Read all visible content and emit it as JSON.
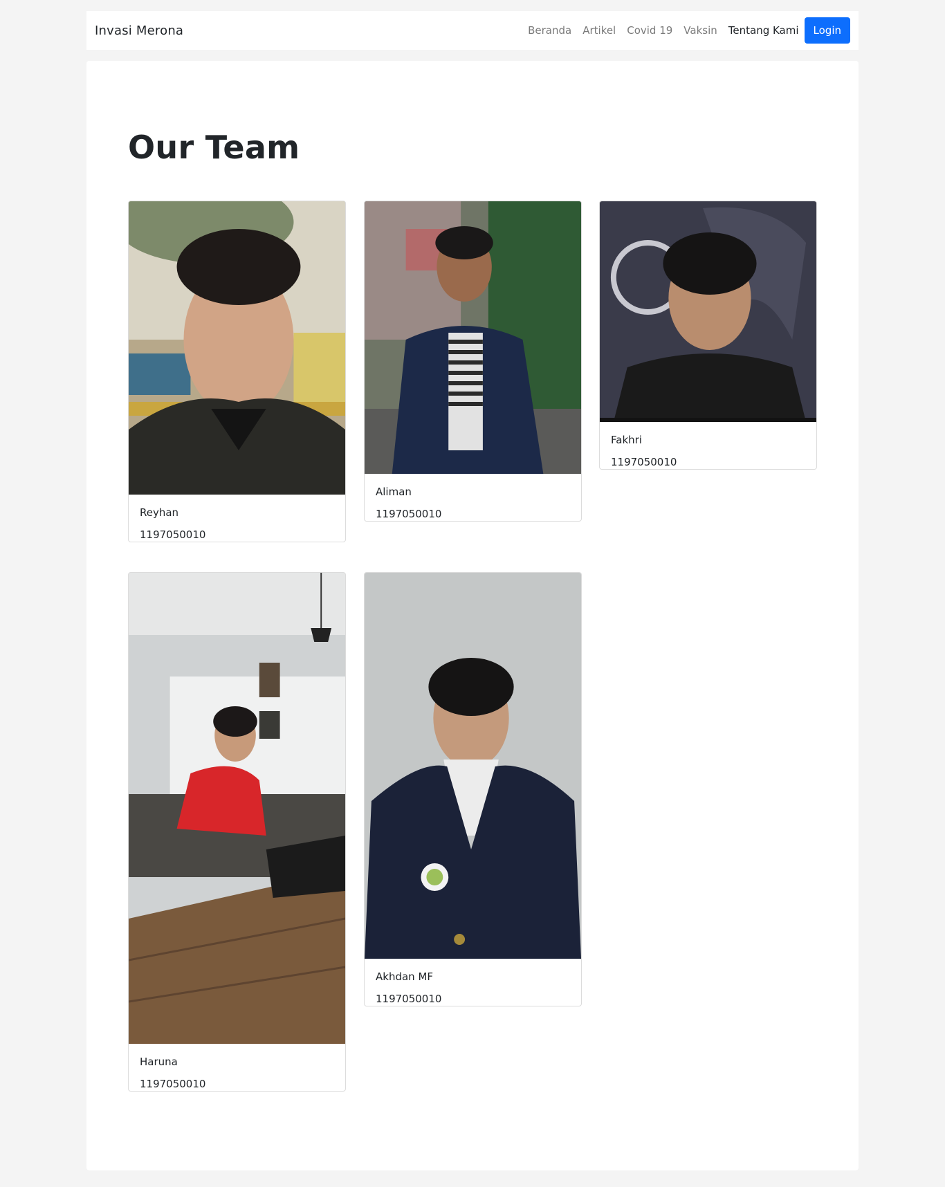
{
  "navbar": {
    "brand": "Invasi Merona",
    "links": [
      {
        "label": "Beranda"
      },
      {
        "label": "Artikel"
      },
      {
        "label": "Covid 19"
      },
      {
        "label": "Vaksin"
      },
      {
        "label": "Tentang Kami"
      }
    ],
    "login_label": "Login"
  },
  "main": {
    "title": "Our Team",
    "members": [
      {
        "name": "Reyhan",
        "id": "1197050010"
      },
      {
        "name": "Aliman",
        "id": "1197050010"
      },
      {
        "name": "Fakhri",
        "id": "1197050010"
      },
      {
        "name": "Haruna",
        "id": "1197050010"
      },
      {
        "name": "Akhdan MF",
        "id": "1197050010"
      }
    ]
  },
  "colors": {
    "page_bg": "#f4f4f4",
    "accent": "#0d6efd",
    "text": "#212529",
    "muted": "#7a7a7a"
  },
  "icons": {
    "photo": "member-photo"
  }
}
